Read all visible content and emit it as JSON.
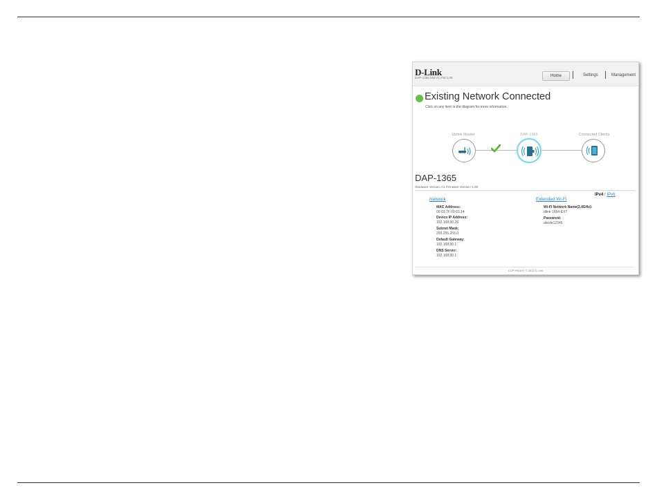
{
  "header": {
    "logo": "D-Link",
    "logo_sub": "DAP-1365   HW:A1   FW:1.00",
    "nav": {
      "home": "Home",
      "settings": "Settings",
      "management": "Management"
    }
  },
  "status": {
    "title": "Existing Network Connected",
    "subtitle": "Click on any item in the diagram for more information.",
    "dot_color": "#6cbe45"
  },
  "diagram": {
    "nodes": [
      {
        "label": "Uplink Router",
        "icon": "router-icon"
      },
      {
        "label": "DAP-1365",
        "icon": "extender-icon"
      },
      {
        "label": "Connected Clients",
        "icon": "client-device-icon"
      }
    ],
    "link_status_icon": "checkmark-icon"
  },
  "device": {
    "title": "DAP-1365",
    "meta": "Hardware Version: A1    Firmware Version: 1.00",
    "ipv4": "IPv4",
    "ipv_sep": "/",
    "ipv6": "IPv6"
  },
  "network": {
    "heading": "Network",
    "mac_label": "MAC Address:",
    "mac_value": "00:03:7F:00:01:14",
    "ip_label": "Device IP Address:",
    "ip_value": "192.168.90.26",
    "mask_label": "Subnet Mask:",
    "mask_value": "255.255.255.0",
    "gateway_label": "Default Gateway:",
    "gateway_value": "192.168.90.1",
    "dns_label": "DNS Server:",
    "dns_value": "192.168.90.1"
  },
  "extended_wifi": {
    "heading": "Extended Wi-Fi",
    "ssid_label": "Wi-Fi Network Name(2.4GHz):",
    "ssid_value": "dlink-1654-EXT",
    "password_label": "Password:",
    "password_value": "abcde12345"
  },
  "footer": {
    "copyright": "COPYRIGHT © 2013 D-Link"
  },
  "colors": {
    "accent": "#2c86c3",
    "connected": "#6cbe45",
    "active_node": "#7fd4e6"
  }
}
